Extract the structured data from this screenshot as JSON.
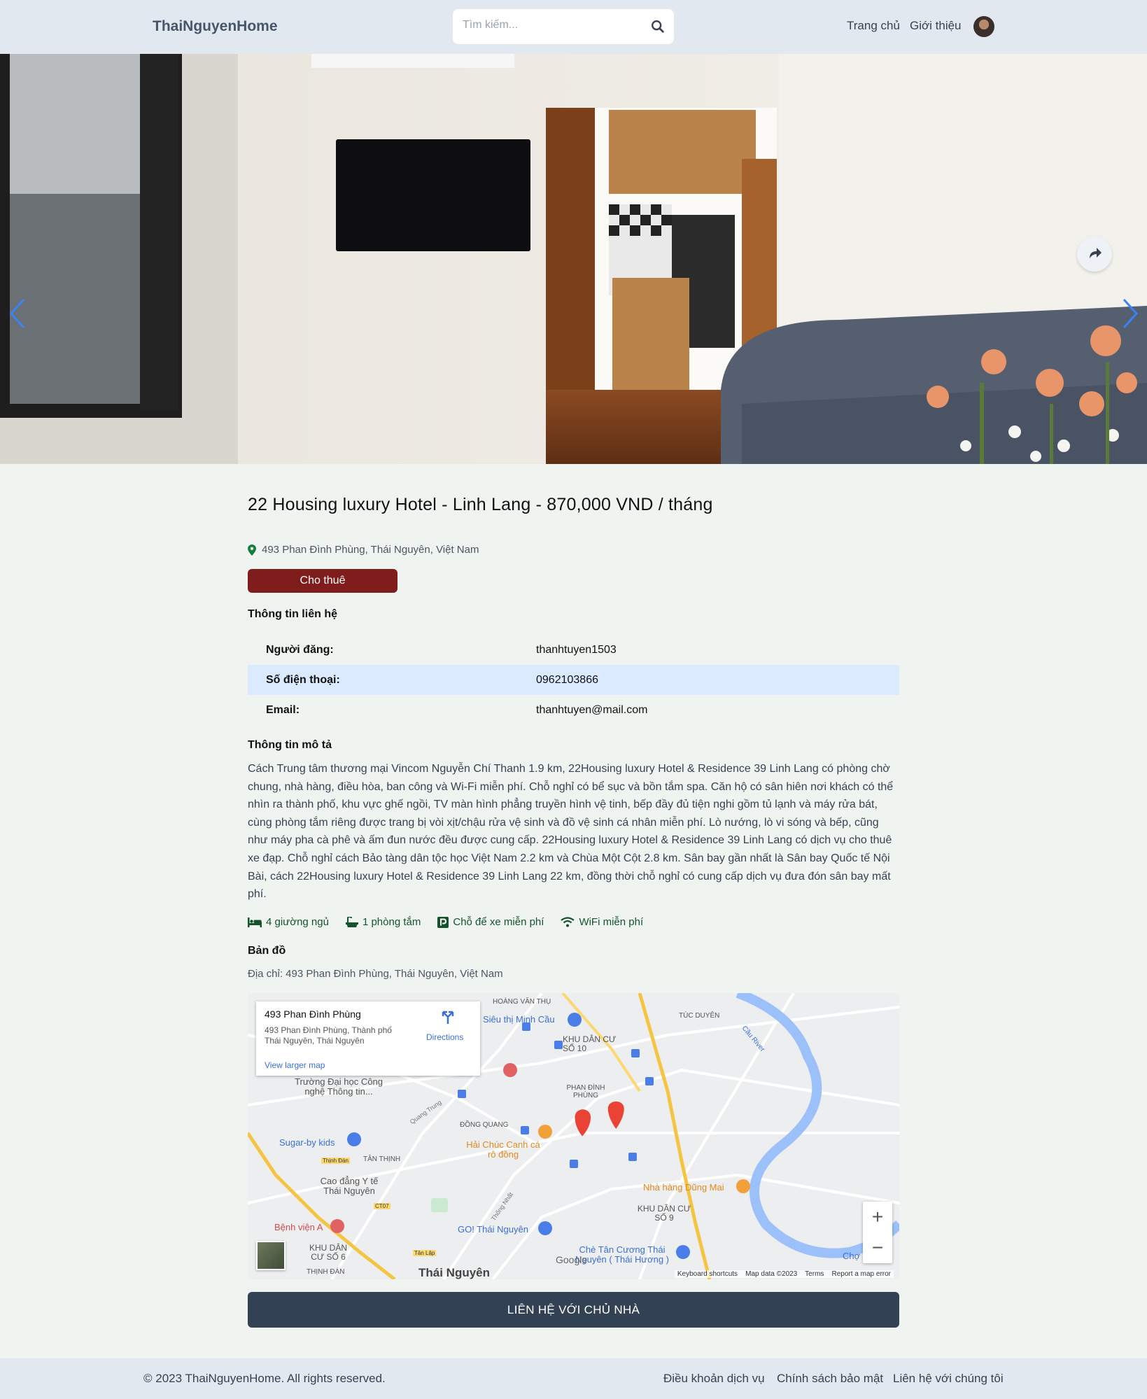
{
  "header": {
    "brand": "ThaiNguyenHome",
    "search_placeholder": "Tìm kiếm...",
    "nav_home": "Trang chủ",
    "nav_about": "Giới thiệu"
  },
  "listing": {
    "title": "22 Housing luxury Hotel - Linh Lang - 870,000 VND / tháng",
    "address": "493 Phan Đình Phùng, Thái Nguyên, Việt Nam",
    "status": "Cho thuê",
    "contact_heading": "Thông tin liên hệ",
    "contact": [
      {
        "label": "Người đăng:",
        "value": "thanhtuyen1503"
      },
      {
        "label": "Số điện thoại:",
        "value": "0962103866"
      },
      {
        "label": "Email:",
        "value": "thanhtuyen@mail.com"
      }
    ],
    "desc_heading": "Thông tin mô tả",
    "description": "Cách Trung tâm thương mại Vincom Nguyễn Chí Thanh 1.9 km, 22Housing luxury Hotel & Residence 39 Linh Lang có phòng chờ chung, nhà hàng, điều hòa, ban công và Wi-Fi miễn phí. Chỗ nghỉ có bể sục và bồn tắm spa. Căn hộ có sân hiên nơi khách có thể nhìn ra thành phố, khu vực ghế ngồi, TV màn hình phẳng truyền hình vệ tinh, bếp đầy đủ tiện nghi gồm tủ lạnh và máy rửa bát, cùng phòng tắm riêng được trang bị vòi xịt/chậu rửa vệ sinh và đồ vệ sinh cá nhân miễn phí. Lò nướng, lò vi sóng và bếp, cũng như máy pha cà phê và ấm đun nước đều được cung cấp. 22Housing luxury Hotel & Residence 39 Linh Lang có dịch vụ cho thuê xe đạp. Chỗ nghỉ cách Bảo tàng dân tộc học Việt Nam 2.2 km và Chùa Một Cột 2.8 km. Sân bay gần nhất là Sân bay Quốc tế Nội Bài, cách 22Housing luxury Hotel & Residence 39 Linh Lang 22 km, đồng thời chỗ nghỉ có cung cấp dịch vụ đưa đón sân bay mất phí.",
    "amenities": {
      "beds": "4 giường ngủ",
      "baths": "1 phòng tắm",
      "parking": "Chỗ để xe miễn phí",
      "wifi": "WiFi miễn phí"
    },
    "map_heading": "Bản đồ",
    "map_address": "Địa chỉ: 493 Phan Đình Phùng, Thái Nguyên, Việt Nam",
    "cta": "LIÊN HỆ VỚI CHỦ NHÀ"
  },
  "map": {
    "card_title": "493 Phan Đình Phùng",
    "card_addr1": "493 Phan Đình Phùng, Thành phố",
    "card_addr2": "Thái Nguyên, Thái Nguyên",
    "directions": "Directions",
    "larger": "View larger map",
    "zoom_in": "+",
    "zoom_out": "−",
    "footer": "Keyboard shortcuts    Map data ©2023    Terms    Report a map error",
    "labels": {
      "hoang_van_thu": "HOÀNG VĂN THỤ",
      "sieu_thi": "Siêu thị Minh Cầu",
      "kdc10": "KHU DÂN CƯ SỐ 10",
      "tuc_duyen": "TÚC DUYÊN",
      "cau_river": "Cầu River",
      "truong": "Trường Đại học Công nghệ Thông tin...",
      "phan_dinh_phung": "PHAN ĐÌNH PHÙNG",
      "dong_quang": "ĐỒNG QUANG",
      "quang_trung": "Quang Trung",
      "sugar": "Sugar-by kids",
      "hai_chuc": "Hải Chúc Canh cá rô đồng",
      "tan_thinh": "TÂN THỊNH",
      "thinh_dan": "Thịnh Đán",
      "cao_dang": "Cao đẳng Y tế Thái Nguyên",
      "nha_hang": "Nhà hàng Dũng Mai",
      "kdc9": "KHU DÂN CƯ SỐ 9",
      "thong_nhat": "Thống Nhất",
      "ct07": "CT07",
      "benh_vien": "Bệnh viện A",
      "go": "GO! Thái Nguyên",
      "che": "Chè Tân Cương Thái Nguyên ( Thái Hương )",
      "kdc6": "KHU DÂN CƯ SỐ 6",
      "thinh_dan_caps": "THỊNH ĐÁN",
      "tan_lap": "Tân Lập",
      "thai_nguyen": "Thái Nguyên",
      "google": "Google",
      "cho": "Chợ"
    }
  },
  "footer": {
    "copyright": "© 2023 ThaiNguyenHome. All rights reserved.",
    "terms": "Điều khoản dịch vụ",
    "privacy": "Chính sách bảo mật",
    "contact": "Liên hệ với chúng tôi"
  },
  "icons": {
    "search": "search-icon",
    "share": "share-icon",
    "prev": "chevron-left-icon",
    "next": "chevron-right-icon",
    "pin": "map-pin-icon",
    "bed": "bed-icon",
    "bath": "bath-icon",
    "parking": "parking-icon",
    "wifi": "wifi-icon"
  },
  "colors": {
    "header_bg": "#e2e8f0",
    "page_bg": "#f0f4f1",
    "status_badge": "#7f1d1d",
    "cta": "#334155",
    "row_highlight": "#dbeafe",
    "amenity_text": "#14532d"
  }
}
